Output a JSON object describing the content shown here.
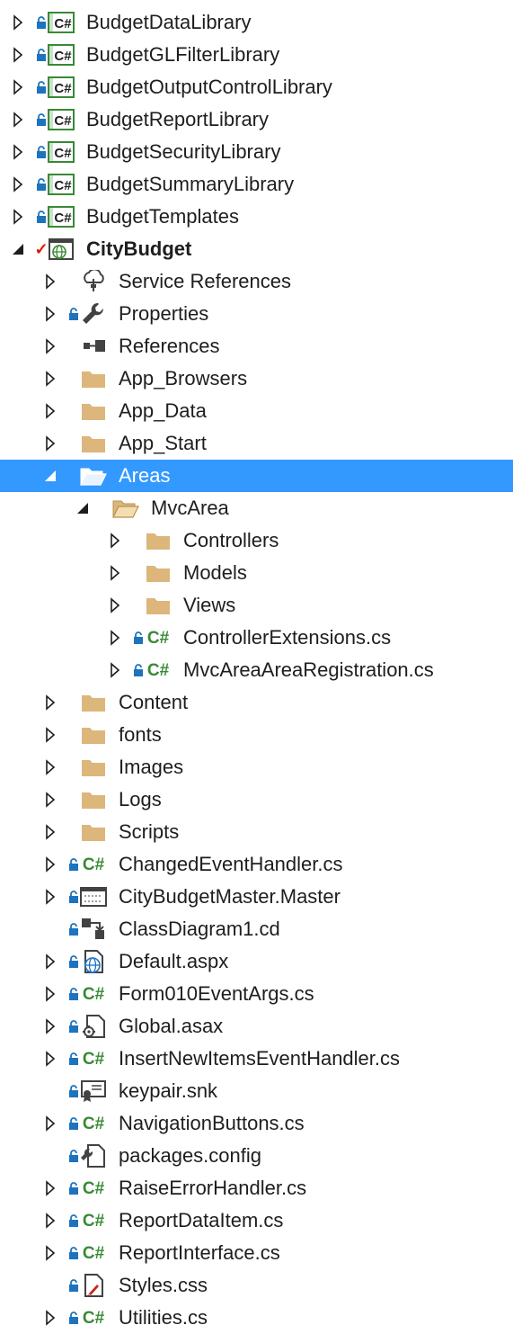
{
  "colors": {
    "selection": "#3399ff",
    "folder": "#dcb67a",
    "csharp": "#388a34",
    "lock": "#1e73be",
    "check": "#e51400"
  },
  "tree": [
    {
      "label": "BudgetDataLibrary",
      "level": 0,
      "expander": "collapsed",
      "lock": true,
      "icon": "csproj-icon"
    },
    {
      "label": "BudgetGLFilterLibrary",
      "level": 0,
      "expander": "collapsed",
      "lock": true,
      "icon": "csproj-icon"
    },
    {
      "label": "BudgetOutputControlLibrary",
      "level": 0,
      "expander": "collapsed",
      "lock": true,
      "icon": "csproj-icon"
    },
    {
      "label": "BudgetReportLibrary",
      "level": 0,
      "expander": "collapsed",
      "lock": true,
      "icon": "csproj-icon"
    },
    {
      "label": "BudgetSecurityLibrary",
      "level": 0,
      "expander": "collapsed",
      "lock": true,
      "icon": "csproj-icon"
    },
    {
      "label": "BudgetSummaryLibrary",
      "level": 0,
      "expander": "collapsed",
      "lock": true,
      "icon": "csproj-icon"
    },
    {
      "label": "BudgetTemplates",
      "level": 0,
      "expander": "collapsed",
      "lock": true,
      "icon": "csproj-icon"
    },
    {
      "label": "CityBudget",
      "level": 0,
      "expander": "expanded",
      "check": true,
      "icon": "web-project-icon",
      "bold": true
    },
    {
      "label": "Service References",
      "level": 1,
      "expander": "collapsed",
      "icon": "service-references-icon"
    },
    {
      "label": "Properties",
      "level": 1,
      "expander": "collapsed",
      "lock": true,
      "icon": "wrench-icon"
    },
    {
      "label": "References",
      "level": 1,
      "expander": "collapsed",
      "icon": "references-icon"
    },
    {
      "label": "App_Browsers",
      "level": 1,
      "expander": "collapsed",
      "icon": "folder-icon"
    },
    {
      "label": "App_Data",
      "level": 1,
      "expander": "collapsed",
      "icon": "folder-icon"
    },
    {
      "label": "App_Start",
      "level": 1,
      "expander": "collapsed",
      "icon": "folder-icon"
    },
    {
      "label": "Areas",
      "level": 1,
      "expander": "expanded",
      "icon": "folder-open-icon",
      "selected": true
    },
    {
      "label": "MvcArea",
      "level": 2,
      "expander": "expanded",
      "icon": "folder-open-icon"
    },
    {
      "label": "Controllers",
      "level": 3,
      "expander": "collapsed",
      "icon": "folder-icon"
    },
    {
      "label": "Models",
      "level": 3,
      "expander": "collapsed",
      "icon": "folder-icon"
    },
    {
      "label": "Views",
      "level": 3,
      "expander": "collapsed",
      "icon": "folder-icon"
    },
    {
      "label": "ControllerExtensions.cs",
      "level": 3,
      "expander": "collapsed",
      "lock": true,
      "icon": "csharp-file-icon"
    },
    {
      "label": "MvcAreaAreaRegistration.cs",
      "level": 3,
      "expander": "collapsed",
      "lock": true,
      "icon": "csharp-file-icon"
    },
    {
      "label": "Content",
      "level": 1,
      "expander": "collapsed",
      "icon": "folder-icon"
    },
    {
      "label": "fonts",
      "level": 1,
      "expander": "collapsed",
      "icon": "folder-icon"
    },
    {
      "label": "Images",
      "level": 1,
      "expander": "collapsed",
      "icon": "folder-icon"
    },
    {
      "label": "Logs",
      "level": 1,
      "expander": "collapsed",
      "icon": "folder-icon"
    },
    {
      "label": "Scripts",
      "level": 1,
      "expander": "collapsed",
      "icon": "folder-icon"
    },
    {
      "label": "ChangedEventHandler.cs",
      "level": 1,
      "expander": "collapsed",
      "lock": true,
      "icon": "csharp-file-icon"
    },
    {
      "label": "CityBudgetMaster.Master",
      "level": 1,
      "expander": "collapsed",
      "lock": true,
      "icon": "master-page-icon"
    },
    {
      "label": "ClassDiagram1.cd",
      "level": 1,
      "expander": "none",
      "lock": true,
      "icon": "class-diagram-icon"
    },
    {
      "label": "Default.aspx",
      "level": 1,
      "expander": "collapsed",
      "lock": true,
      "icon": "web-page-icon"
    },
    {
      "label": "Form010EventArgs.cs",
      "level": 1,
      "expander": "collapsed",
      "lock": true,
      "icon": "csharp-file-icon"
    },
    {
      "label": "Global.asax",
      "level": 1,
      "expander": "collapsed",
      "lock": true,
      "icon": "global-asax-icon"
    },
    {
      "label": "InsertNewItemsEventHandler.cs",
      "level": 1,
      "expander": "collapsed",
      "lock": true,
      "icon": "csharp-file-icon"
    },
    {
      "label": "keypair.snk",
      "level": 1,
      "expander": "none",
      "lock": true,
      "icon": "certificate-icon"
    },
    {
      "label": "NavigationButtons.cs",
      "level": 1,
      "expander": "collapsed",
      "lock": true,
      "icon": "csharp-file-icon"
    },
    {
      "label": "packages.config",
      "level": 1,
      "expander": "none",
      "lock": true,
      "icon": "config-file-icon"
    },
    {
      "label": "RaiseErrorHandler.cs",
      "level": 1,
      "expander": "collapsed",
      "lock": true,
      "icon": "csharp-file-icon"
    },
    {
      "label": "ReportDataItem.cs",
      "level": 1,
      "expander": "collapsed",
      "lock": true,
      "icon": "csharp-file-icon"
    },
    {
      "label": "ReportInterface.cs",
      "level": 1,
      "expander": "collapsed",
      "lock": true,
      "icon": "csharp-file-icon"
    },
    {
      "label": "Styles.css",
      "level": 1,
      "expander": "none",
      "lock": true,
      "icon": "stylesheet-icon"
    },
    {
      "label": "Utilities.cs",
      "level": 1,
      "expander": "collapsed",
      "lock": true,
      "icon": "csharp-file-icon"
    }
  ]
}
